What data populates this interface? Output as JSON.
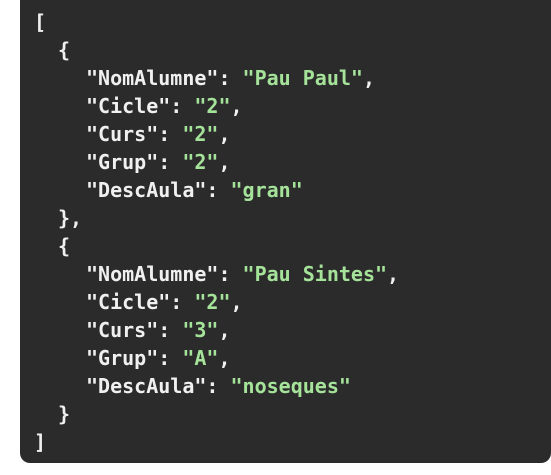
{
  "colors": {
    "background": "#2b2b2b",
    "page": "#ffffff",
    "text": "#f0f0f0",
    "string": "#a6e39a"
  },
  "code": {
    "open_array": "[",
    "close_array": "]",
    "open_object": "{",
    "close_object_comma": "},",
    "close_object": "}",
    "records": [
      {
        "fields": [
          {
            "key": "\"NomAlumne\"",
            "value": "\"Pau Paul\"",
            "trail": ","
          },
          {
            "key": "\"Cicle\"",
            "value": "\"2\"",
            "trail": ","
          },
          {
            "key": "\"Curs\"",
            "value": "\"2\"",
            "trail": ","
          },
          {
            "key": "\"Grup\"",
            "value": "\"2\"",
            "trail": ","
          },
          {
            "key": "\"DescAula\"",
            "value": "\"gran\"",
            "trail": ""
          }
        ]
      },
      {
        "fields": [
          {
            "key": "\"NomAlumne\"",
            "value": "\"Pau Sintes\"",
            "trail": ","
          },
          {
            "key": "\"Cicle\"",
            "value": "\"2\"",
            "trail": ","
          },
          {
            "key": "\"Curs\"",
            "value": "\"3\"",
            "trail": ","
          },
          {
            "key": "\"Grup\"",
            "value": "\"A\"",
            "trail": ","
          },
          {
            "key": "\"DescAula\"",
            "value": "\"noseques\"",
            "trail": ""
          }
        ]
      }
    ]
  }
}
